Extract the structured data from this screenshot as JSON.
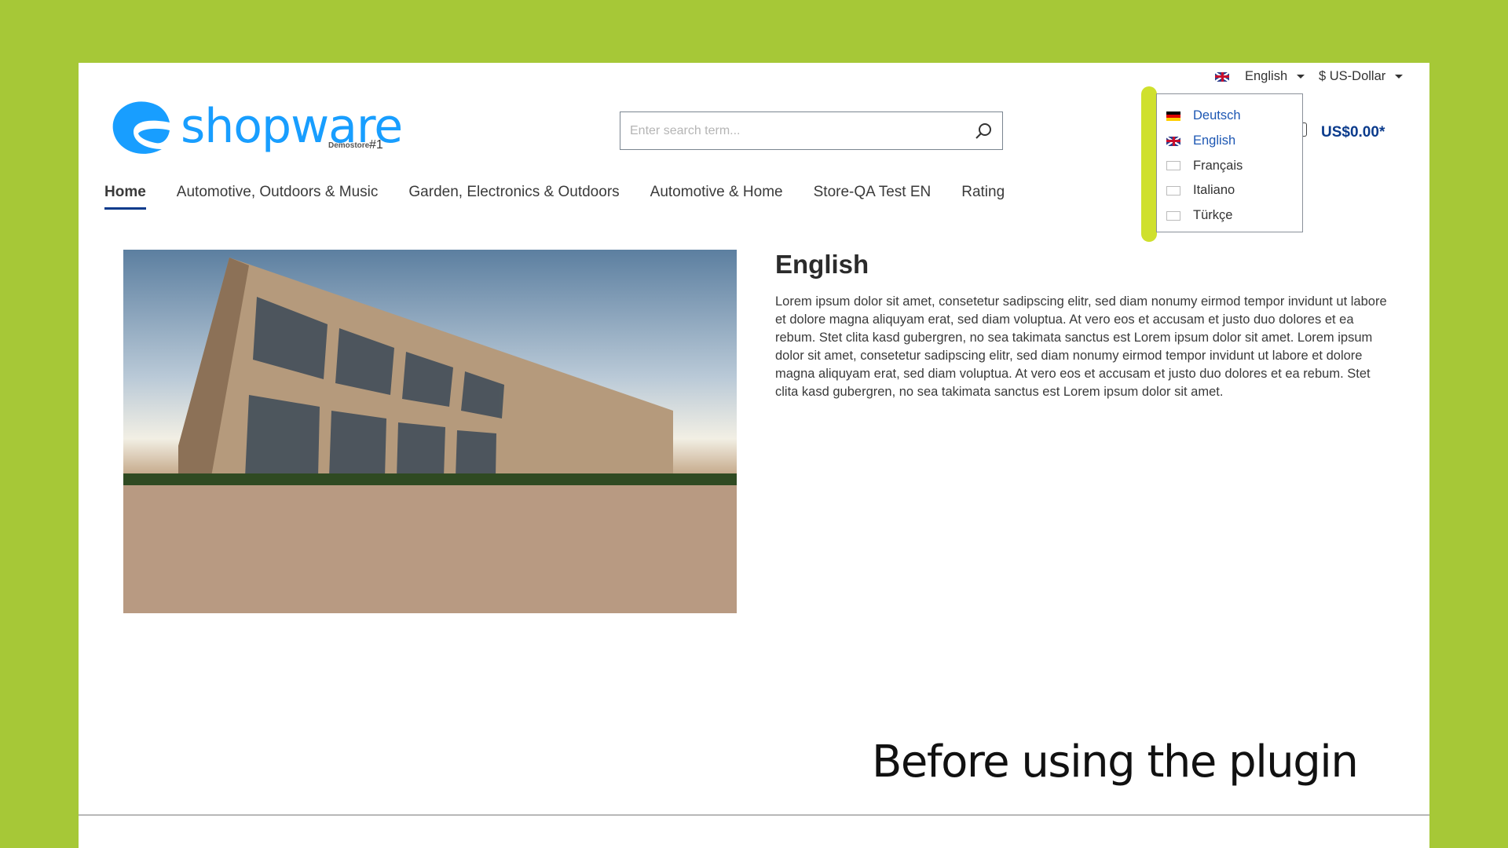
{
  "brand": {
    "logo": "shopware",
    "sub": "Demostore",
    "num": "#1",
    "color": "#189eff"
  },
  "search": {
    "placeholder": "Enter search term..."
  },
  "nav": [
    "Home",
    "Automotive, Outdoors & Music",
    "Garden, Electronics & Outdoors",
    "Automotive & Home",
    "Store-QA Test EN",
    "Rating"
  ],
  "topbar": {
    "language": "English",
    "currency": "$ US-Dollar"
  },
  "cart": {
    "total": "US$0.00*"
  },
  "language_dropdown": [
    {
      "label": "Deutsch",
      "flag": "de-flag"
    },
    {
      "label": "English",
      "flag": "uk-flag"
    },
    {
      "label": "Français",
      "flag": "empty-flag"
    },
    {
      "label": "Italiano",
      "flag": "empty-flag"
    },
    {
      "label": "Türkçe",
      "flag": "empty-flag"
    }
  ],
  "content": {
    "heading": "English",
    "paragraph": "Lorem ipsum dolor sit amet, consetetur sadipscing elitr, sed diam nonumy eirmod tempor invidunt ut labore et dolore magna aliquyam erat, sed diam voluptua. At vero eos et accusam et justo duo dolores et ea rebum. Stet clita kasd gubergren, no sea takimata sanctus est Lorem ipsum dolor sit amet. Lorem ipsum dolor sit amet, consetetur sadipscing elitr, sed diam nonumy eirmod tempor invidunt ut labore et dolore magna aliquyam erat, sed diam voluptua. At vero eos et accusam et justo duo dolores et ea rebum. Stet clita kasd gubergren, no sea takimata sanctus est Lorem ipsum dolor sit amet."
  },
  "caption": "Before using the plugin",
  "colors": {
    "background": "#a6c837",
    "highlight": "#cfe02d",
    "accent": "#0b3b8c",
    "link": "#1d57b3"
  }
}
